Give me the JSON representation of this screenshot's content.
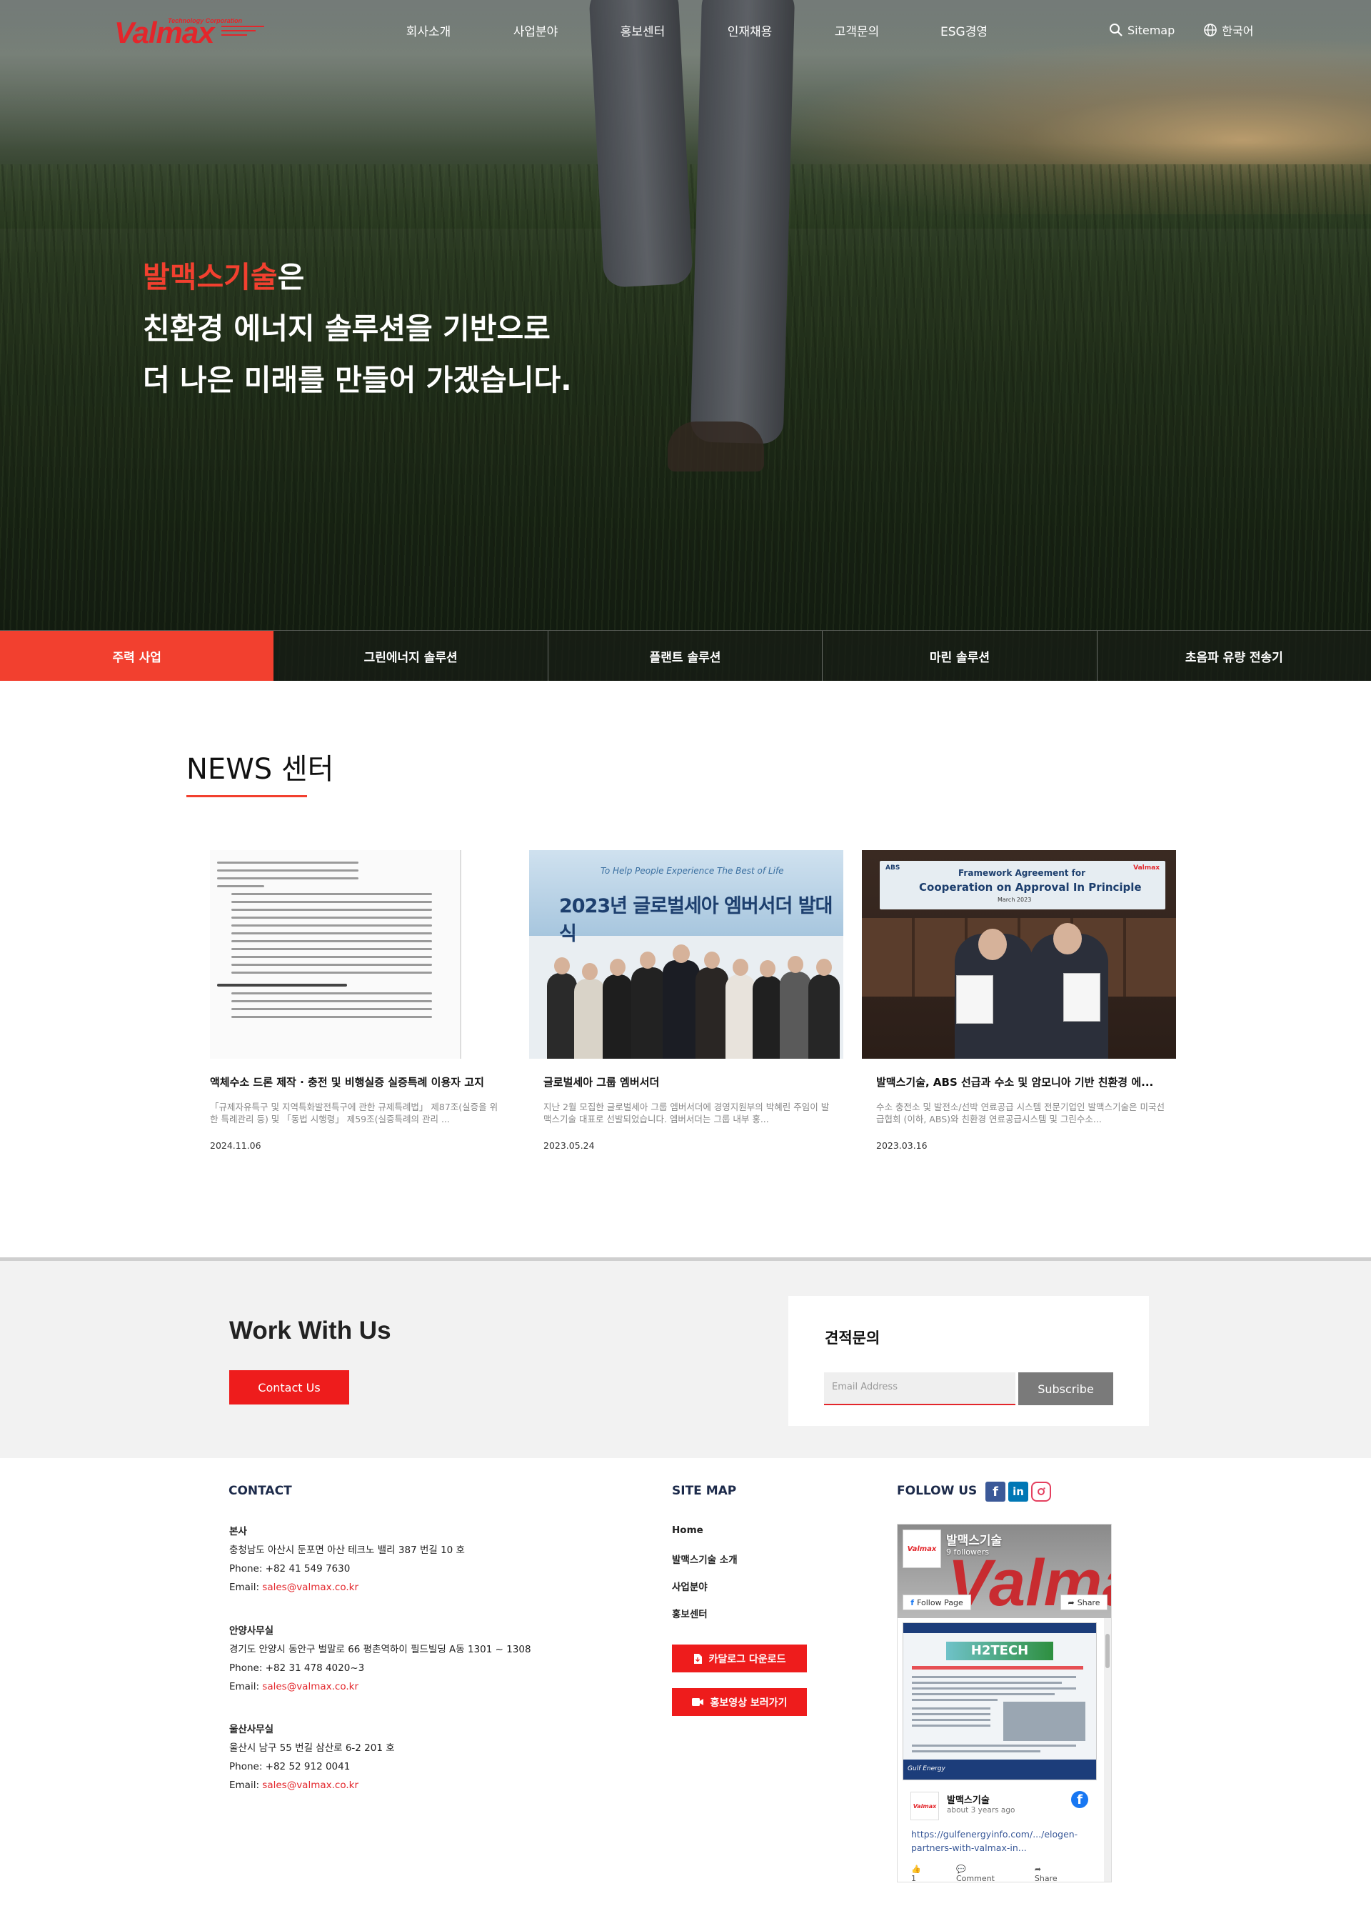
{
  "header": {
    "logo_text": "Valmax",
    "logo_sub": "Technology Corporation",
    "nav": [
      "회사소개",
      "사업분야",
      "홍보센터",
      "인재채용",
      "고객문의",
      "ESG경영"
    ],
    "sitemap_label": "Sitemap",
    "language_label": "한국어"
  },
  "hero": {
    "line1_highlight": "발맥스기술",
    "line1_rest": "은",
    "line2": "친환경 에너지 솔루션을 기반으로",
    "line3": "더 나은 미래를 만들어 가겠습니다."
  },
  "tabs": [
    {
      "label": "주력 사업",
      "active": true
    },
    {
      "label": "그린에너지 솔루션",
      "active": false
    },
    {
      "label": "플랜트 솔루션",
      "active": false
    },
    {
      "label": "마린 솔루션",
      "active": false
    },
    {
      "label": "초음파 유량 전송기",
      "active": false
    }
  ],
  "news": {
    "title": "NEWS 센터",
    "cards": [
      {
        "title": "액체수소 드론 제작 · 충전 및 비행실증 실증특례 이용자 고지",
        "desc": "「규제자유특구 및 지역특화발전특구에 관한 규제특례법」 제87조(실증을 위한 특례관리 등) 및 「동법 시행령」 제59조(실증특례의 관리 ...",
        "date": "2024.11.06"
      },
      {
        "title": "글로벌세아 그룹 엠버서더",
        "desc": "지난 2월 모집한 글로벌세아 그룹 엠버서더에 경영지원부의 박혜린 주임이 발맥스기술 대표로 선발되었습니다. 엠버서더는 그룹 내부 홍...",
        "date": "2023.05.24",
        "image_banner_top": "To Help People Experience The Best of Life",
        "image_banner_main": "2023년 글로벌세아 엠버서더 발대식"
      },
      {
        "title": "발맥스기술, ABS 선급과 수소 및 암모니아 기반 친환경 에...",
        "desc": "수소 충전소 및 발전소/선박 연료공급 시스템 전문기업인 발맥스기술은 미국선급협회 (이하, ABS)와 친환경 연료공급시스템 및 그린수소...",
        "date": "2023.03.16",
        "image_banner_top": "Framework Agreement for",
        "image_banner_main": "Cooperation on Approval In Principle",
        "image_banner_date": "March 2023",
        "image_logo_left": "ABS",
        "image_logo_right": "Valmax"
      }
    ]
  },
  "work": {
    "title": "Work With Us",
    "contact_button": "Contact Us",
    "quote_title": "견적문의",
    "email_placeholder": "Email Address",
    "subscribe_button": "Subscribe"
  },
  "footer": {
    "contact_title": "CONTACT",
    "offices": [
      {
        "name": "본사",
        "address": "충청남도 아산시 둔포면 아산 테크노 밸리 387 번길 10 호",
        "phone": "Phone: +82 41 549 7630",
        "email_label": "Email: ",
        "email": "sales@valmax.co.kr"
      },
      {
        "name": "안양사무실",
        "address": "경기도 안양시 동안구 벌말로 66 평촌역하이 필드빌딩 A동 1301 ~ 1308",
        "phone": "Phone: +82 31 478 4020~3",
        "email_label": "Email: ",
        "email": "sales@valmax.co.kr"
      },
      {
        "name": "울산사무실",
        "address": "울산시 남구 55 번길 삼산로 6-2 201 호",
        "phone": "Phone: +82 52 912 0041",
        "email_label": "Email: ",
        "email": "sales@valmax.co.kr"
      }
    ],
    "sitemap_title": "SITE MAP",
    "sitemap_links": [
      "Home",
      "발맥스기술 소개",
      "사업분야",
      "홍보센터"
    ],
    "catalog_button": "카달로그 다운로드",
    "video_button": "홍보영상 보러가기",
    "follow_title": "FOLLOW US",
    "social_icons": [
      "facebook-icon",
      "linkedin-icon",
      "instagram-icon"
    ],
    "fb": {
      "page_name": "발맥스기술",
      "followers": "9 followers",
      "follow_label": "Follow Page",
      "share_label": "Share",
      "cover_text": "Valmax",
      "logo_text": "Valmax",
      "post_headline": "H2TECH",
      "post_footer": "Gulf Energy",
      "card_name": "발맥스기술",
      "card_time": "about 3 years ago",
      "card_link": "https://gulfenergyinfo.com/.../elogen-partners-with-valmax-in...",
      "likes": "1",
      "comment_label": "Comment",
      "share_action": "Share"
    }
  },
  "colors": {
    "accent_red": "#f2402f",
    "button_red": "#ee1c1c",
    "navy": "#1c2a4a"
  }
}
